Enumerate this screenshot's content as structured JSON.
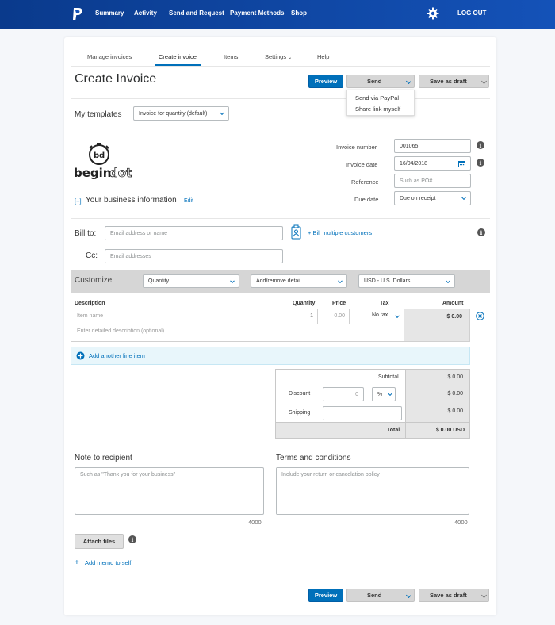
{
  "topnav": {
    "items": [
      "Summary",
      "Activity",
      "Send and Request",
      "Payment Methods",
      "Shop"
    ],
    "logout": "LOG OUT"
  },
  "tabs": [
    "Manage invoices",
    "Create invoice",
    "Items",
    "Settings",
    "Help"
  ],
  "header": {
    "title": "Create Invoice",
    "preview": "Preview",
    "send": "Send",
    "save_draft": "Save as draft"
  },
  "send_menu": [
    "Send via PayPal",
    "Share link myself"
  ],
  "templates": {
    "label": "My templates",
    "selected": "Invoice for quantity (default)"
  },
  "business": {
    "logo_text_a": "begin",
    "logo_text_b": "dot",
    "plus": "[+]",
    "label": "Your business information",
    "edit": "Edit"
  },
  "meta": {
    "invoice_number_label": "Invoice number",
    "invoice_number": "001065",
    "invoice_date_label": "Invoice date",
    "invoice_date": "16/04/2018",
    "reference_label": "Reference",
    "reference_placeholder": "Such as PO#",
    "due_date_label": "Due date",
    "due_date": "Due on receipt"
  },
  "bill": {
    "bill_to_label": "Bill to:",
    "bill_to_placeholder": "Email address or name",
    "multiple": "+ Bill multiple customers",
    "cc_label": "Cc:",
    "cc_placeholder": "Email addresses"
  },
  "customize": {
    "label": "Customize",
    "quantity": "Quantity",
    "detail": "Add/remove detail",
    "currency": "USD - U.S. Dollars"
  },
  "table": {
    "headers": [
      "Description",
      "Quantity",
      "Price",
      "Tax",
      "Amount"
    ],
    "item_placeholder": "Item name",
    "qty": "1",
    "price": "0.00",
    "tax": "No tax",
    "amount": "$ 0.00",
    "desc_placeholder": "Enter detailed description (optional)",
    "add_line": "Add another line item"
  },
  "totals": {
    "subtotal_label": "Subtotal",
    "subtotal": "$ 0.00",
    "discount_label": "Discount",
    "discount_value": "0",
    "discount_unit": "%",
    "discount": "$ 0.00",
    "shipping_label": "Shipping",
    "shipping": "$ 0.00",
    "total_label": "Total",
    "total": "$ 0.00 USD"
  },
  "notes": {
    "note_label": "Note to recipient",
    "note_placeholder": "Such as \"Thank you for your business\"",
    "note_count": "4000",
    "terms_label": "Terms and conditions",
    "terms_placeholder": "Include your return or cancelation policy",
    "terms_count": "4000"
  },
  "footer": {
    "attach": "Attach files",
    "memo": "Add memo to self",
    "preview": "Preview",
    "send": "Send",
    "save_draft": "Save as draft"
  },
  "colors": {
    "brand": "#0070ba",
    "topbar": "#0a3a8c"
  }
}
